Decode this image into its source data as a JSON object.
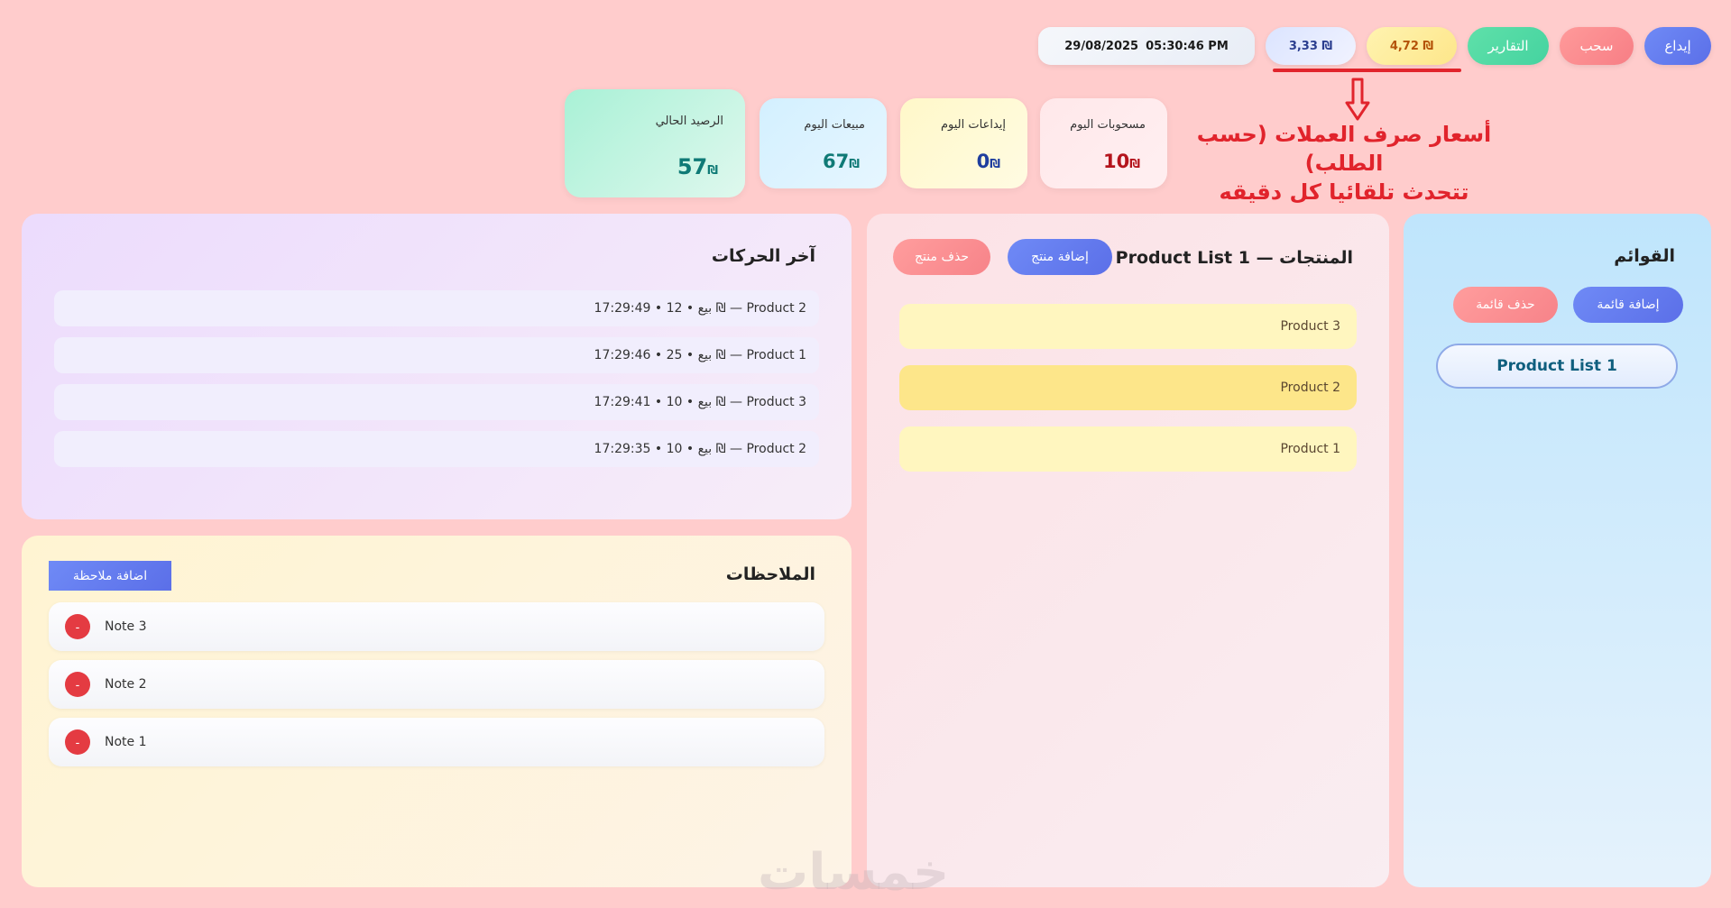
{
  "topbar": {
    "deposit_label": "إيداع",
    "withdraw_label": "سحب",
    "reports_label": "التقارير",
    "rate_yellow": "4,72 ₪",
    "rate_blue": "3,33 ₪",
    "date": "29/08/2025",
    "time": "05:30:46 PM"
  },
  "annotation": {
    "line1": "أسعار صرف العملات (حسب الطلب)",
    "line2": "تتحدث تلقائيا كل دقيقه"
  },
  "stats": {
    "withdrawals": {
      "label": "مسحوبات اليوم",
      "value": "10",
      "currency": "₪"
    },
    "deposits": {
      "label": "إيداعات اليوم",
      "value": "0",
      "currency": "₪"
    },
    "sales": {
      "label": "مبيعات اليوم",
      "value": "67",
      "currency": "₪"
    },
    "balance": {
      "label": "الرصيد الحالي",
      "value": "57",
      "currency": "₪"
    }
  },
  "lists": {
    "title": "القوائم",
    "add_label": "إضافة قائمة",
    "delete_label": "حذف قائمة",
    "items": [
      "Product List 1"
    ]
  },
  "products": {
    "title": "المنتجات — Product List 1",
    "add_label": "إضافة منتج",
    "delete_label": "حذف منتج",
    "items": [
      "Product 3",
      "Product 2",
      "Product 1"
    ]
  },
  "moves": {
    "title": "آخر الحركات",
    "items": [
      "17:29:49 • بيع • 12 ₪ — Product 2",
      "17:29:46 • بيع • 25 ₪ — Product 1",
      "17:29:41 • بيع • 10 ₪ — Product 3",
      "17:29:35 • بيع • 10 ₪ — Product 2"
    ]
  },
  "notes": {
    "title": "الملاحظات",
    "add_label": "اضافة ملاحظة",
    "delete_symbol": "-",
    "items": [
      "Note 3",
      "Note 2",
      "Note 1"
    ]
  },
  "watermark": "خمسات",
  "colors": {
    "background": "#ffcccc",
    "accent_blue": "#5b6fe8",
    "accent_red": "#e1242c",
    "accent_green": "#45d3a0"
  }
}
